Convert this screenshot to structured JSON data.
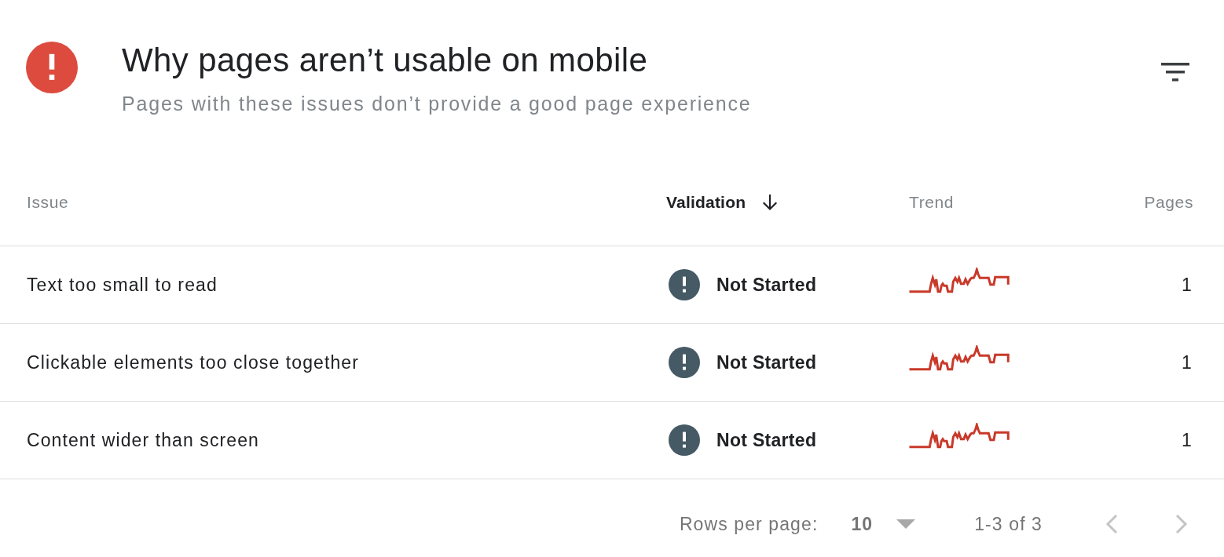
{
  "header": {
    "title": "Why pages aren’t usable on mobile",
    "subtitle": "Pages with these issues don’t provide a good page experience"
  },
  "table": {
    "columns": [
      {
        "label": "Issue",
        "sorted": false
      },
      {
        "label": "Validation",
        "sorted": true
      },
      {
        "label": "Trend",
        "sorted": false
      },
      {
        "label": "Pages",
        "sorted": false
      }
    ],
    "rows": [
      {
        "issue": "Text too small to read",
        "validation": "Not Started",
        "pages": "1"
      },
      {
        "issue": "Clickable elements too close together",
        "validation": "Not Started",
        "pages": "1"
      },
      {
        "issue": "Content wider than screen",
        "validation": "Not Started",
        "pages": "1"
      }
    ]
  },
  "pagination": {
    "rows_per_page_label": "Rows per page:",
    "rows_per_page": "10",
    "range": "1-3 of 3",
    "previous": {
      "disabled": true
    },
    "next": {
      "disabled": true
    }
  }
}
